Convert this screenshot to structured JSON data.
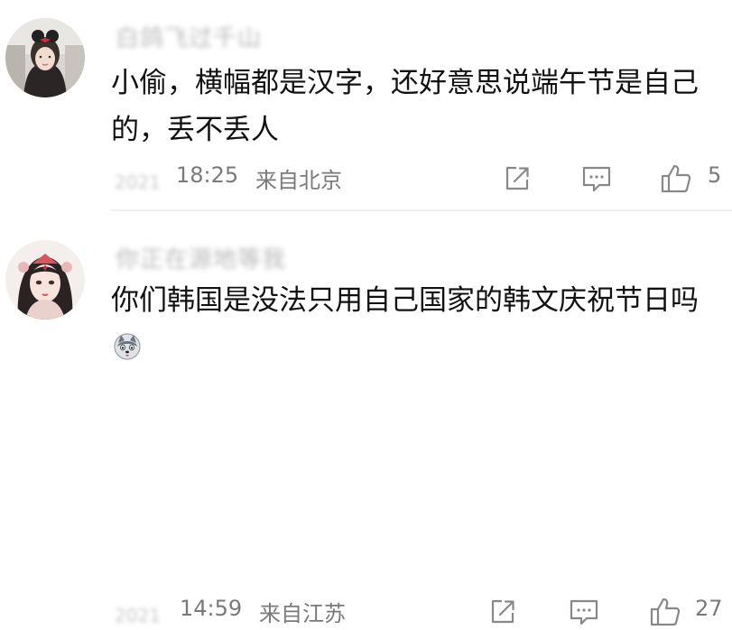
{
  "comments": [
    {
      "username": "白鸽飞过千山",
      "text": "小偷，横幅都是汉字，还好意思说端午节是自己的，丢不丢人",
      "meta_prefix": "2021",
      "time": "18:25",
      "location": "来自北京",
      "likes": "5",
      "avatar_icon": "girl-with-bow-avatar"
    },
    {
      "username": "你正在源地等我",
      "text": "你们韩国是没法只用自己国家的韩文庆祝节日吗",
      "emoji_icon": "husky-face-emoji",
      "meta_prefix": "2021",
      "time": "14:59",
      "location": "来自江苏",
      "likes": "27",
      "avatar_icon": "ancient-style-girl-avatar"
    }
  ],
  "icons": {
    "share": "share-icon",
    "reply": "comment-icon",
    "like": "thumbs-up-icon"
  },
  "colors": {
    "text": "#111111",
    "meta": "#7a7a7a",
    "icon": "#888888",
    "divider": "#efefef"
  }
}
